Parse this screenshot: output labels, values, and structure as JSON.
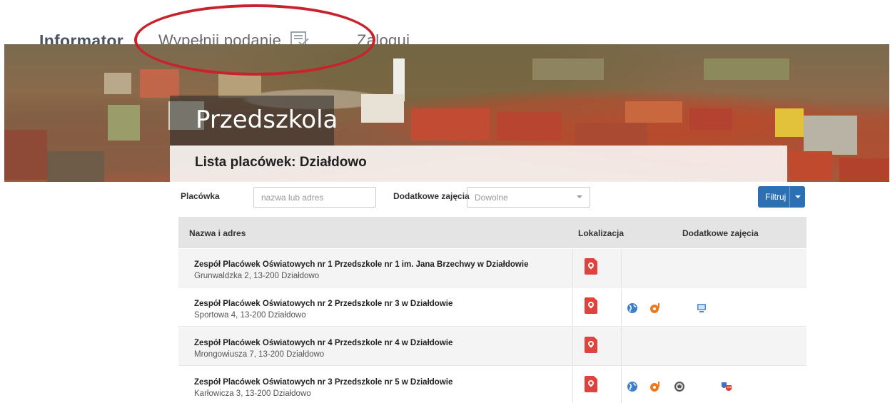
{
  "nav": {
    "brand": "Informator",
    "apply": "Wypełnij podanie",
    "login": "Zaloguj"
  },
  "hero": {
    "title": "Przedszkola",
    "list_title": "Lista placówek: Działdowo"
  },
  "filters": {
    "place_label": "Placówka",
    "search_placeholder": "nazwa lub adres",
    "extra_label": "Dodatkowe zajęcia",
    "extra_value": "Dowolne",
    "filter_button": "Filtruj"
  },
  "table": {
    "headers": {
      "name": "Nazwa i adres",
      "location": "Lokalizacja",
      "extra": "Dodatkowe zajęcia"
    },
    "rows": [
      {
        "name": "Zespół Placówek Oświatowych nr 1 Przedszkole nr 1 im. Jana Brzechwy w Działdowie",
        "address": "Grunwaldzka 2, 13-200 Działdowo",
        "activities": []
      },
      {
        "name": "Zespół Placówek Oświatowych nr 2 Przedszkole nr 3 w Działdowie",
        "address": "Sportowa 4, 13-200 Działdowo",
        "activities": [
          "globe-icon",
          "music-icon",
          "computer-icon"
        ]
      },
      {
        "name": "Zespół Placówek Oświatowych nr 4 Przedszkole nr 4 w Działdowie",
        "address": "Mrongowiusza 7, 13-200 Działdowo",
        "activities": []
      },
      {
        "name": "Zespół Placówek Oświatowych nr 3 Przedszkole nr 5 w Działdowie",
        "address": "Karłowicza 3, 13-200 Działdowo",
        "activities": [
          "globe-icon",
          "music-icon",
          "ball-icon",
          "theater-icon"
        ]
      }
    ]
  },
  "colors": {
    "accent": "#2d6fb3",
    "pin": "#e0433d",
    "highlight_ellipse": "#c8232c"
  }
}
